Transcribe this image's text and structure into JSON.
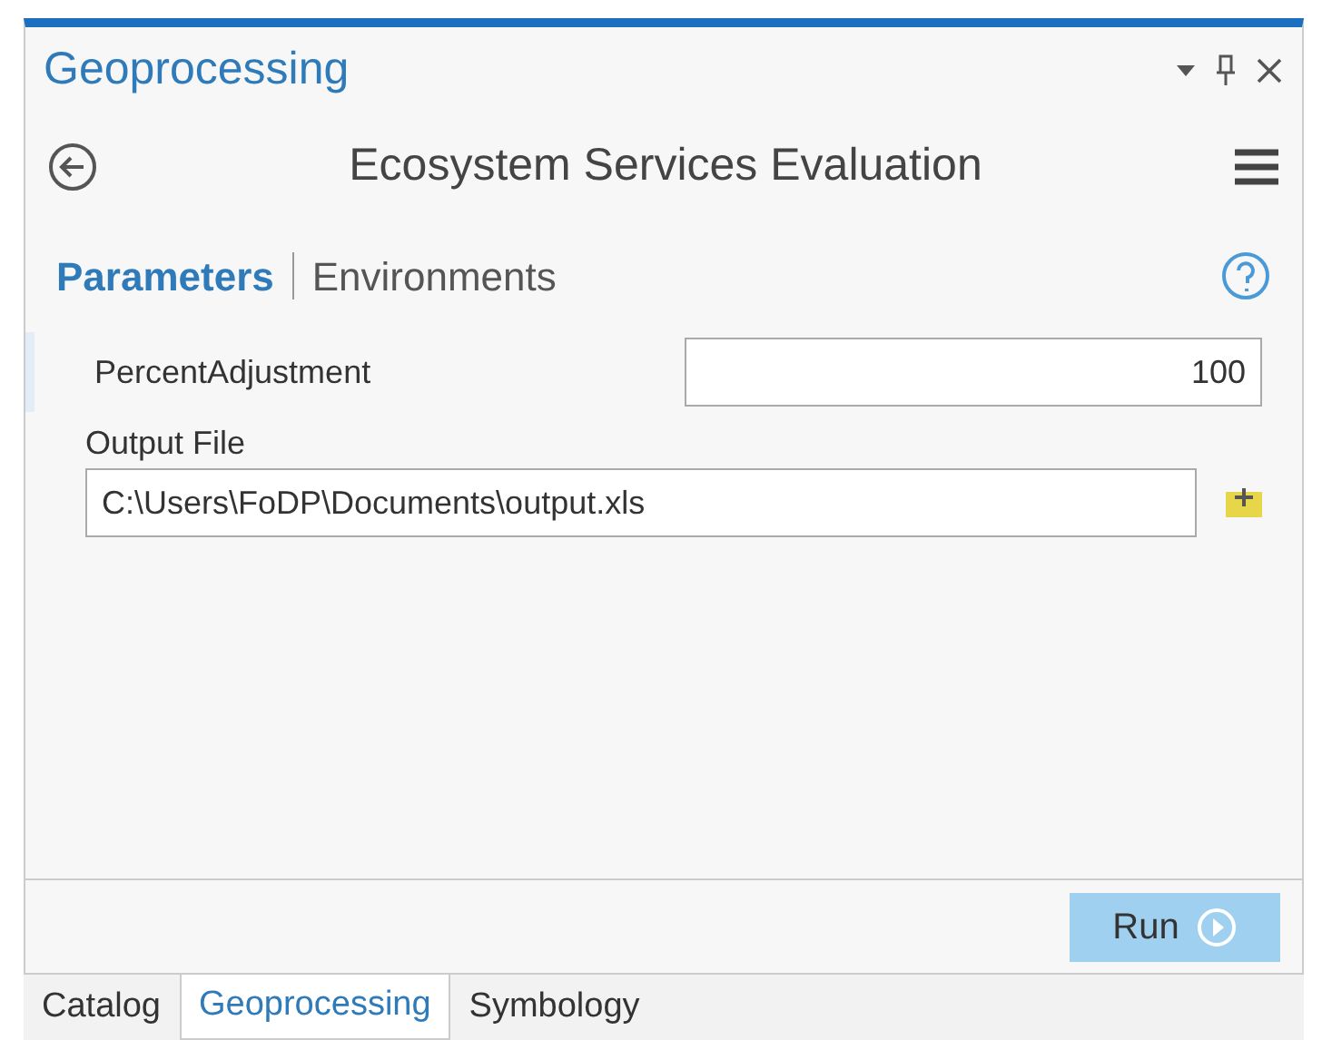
{
  "pane": {
    "title": "Geoprocessing"
  },
  "tool": {
    "title": "Ecosystem Services Evaluation"
  },
  "tabs": [
    {
      "label": "Parameters",
      "selected": true
    },
    {
      "label": "Environments",
      "selected": false
    }
  ],
  "parameters": [
    {
      "kind": "inline",
      "label": "PercentAdjustment",
      "value": "100"
    },
    {
      "kind": "file",
      "label": "Output File",
      "value": "C:\\Users\\FoDP\\Documents\\output.xls"
    }
  ],
  "run_button": {
    "label": "Run"
  },
  "dock_tabs": [
    {
      "label": "Catalog",
      "selected": false
    },
    {
      "label": "Geoprocessing",
      "selected": true
    },
    {
      "label": "Symbology",
      "selected": false
    }
  ]
}
